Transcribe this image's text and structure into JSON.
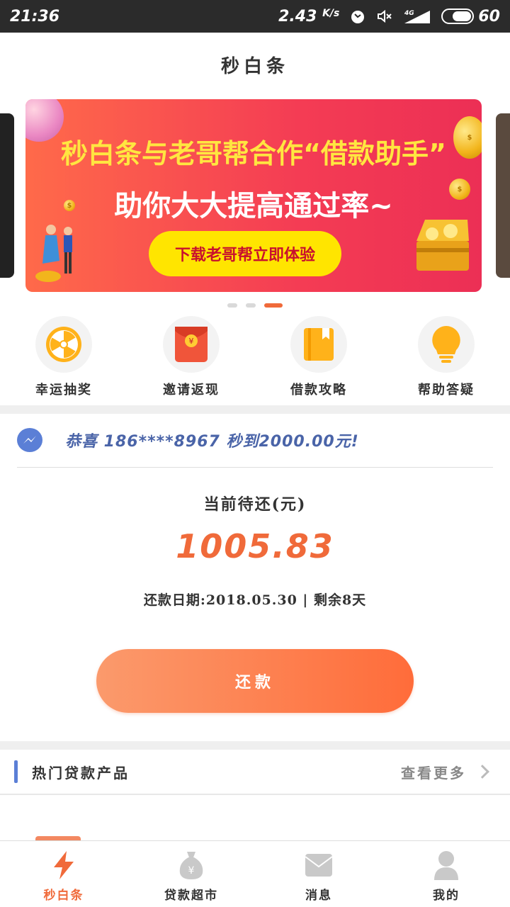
{
  "status_bar": {
    "time": "21:36",
    "net_speed": "2.43",
    "net_unit": "K/s",
    "battery": "60"
  },
  "header": {
    "title": "秒白条"
  },
  "banner": {
    "line1": "秒白条与老哥帮合作“借款助手”",
    "line2": "助你大大提高通过率~",
    "cta": "下载老哥帮立即体验",
    "page_count": 3,
    "active_page": 3
  },
  "quick_actions": [
    {
      "label": "幸运抽奖",
      "icon": "lucky-wheel-icon"
    },
    {
      "label": "邀请返现",
      "icon": "red-envelope-icon"
    },
    {
      "label": "借款攻略",
      "icon": "book-icon"
    },
    {
      "label": "帮助答疑",
      "icon": "lightbulb-icon"
    }
  ],
  "notice": {
    "text": "恭喜 186****8967 秒到2000.00元!"
  },
  "repayment": {
    "label": "当前待还(元)",
    "amount": "1005.83",
    "date_text": "还款日期:2018.05.30 | 剩余8天",
    "button": "还款"
  },
  "hot_loans": {
    "title": "热门贷款产品",
    "more": "查看更多"
  },
  "bottom_nav": [
    {
      "label": "秒白条",
      "icon": "lightning-icon",
      "active": true
    },
    {
      "label": "贷款超市",
      "icon": "money-bag-icon",
      "active": false
    },
    {
      "label": "消息",
      "icon": "message-icon",
      "active": false
    },
    {
      "label": "我的",
      "icon": "user-icon",
      "active": false
    }
  ],
  "colors": {
    "accent": "#f06a3a",
    "notice_text": "#4a64a8",
    "banner_yellow": "#ffe640"
  }
}
